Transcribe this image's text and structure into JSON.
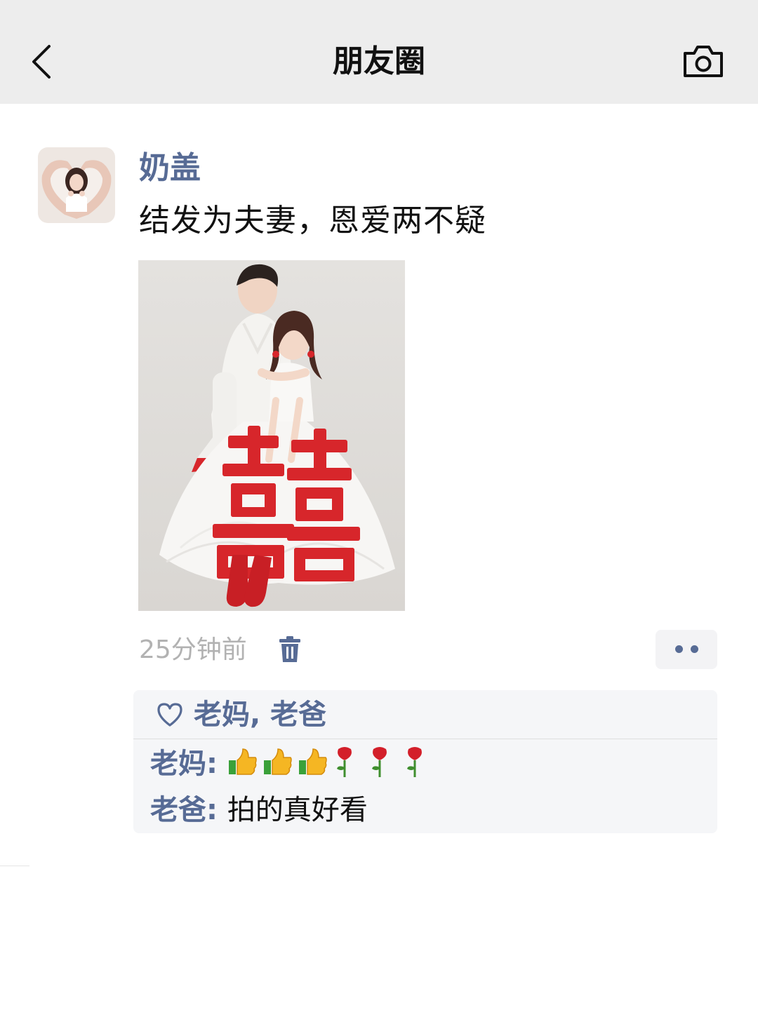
{
  "nav": {
    "title": "朋友圈",
    "back_icon": "chevron-left-icon",
    "camera_icon": "camera-icon"
  },
  "post": {
    "author": "奶盖",
    "text": "结发为夫妻，恩爱两不疑",
    "time": "25分钟前",
    "delete_icon": "trash-icon",
    "more_icon": "more-dots-icon"
  },
  "likes": {
    "names": "老妈, 老爸"
  },
  "comments": [
    {
      "author": "老妈",
      "separator": ": ",
      "content": "👍👍👍🌹🌹🌹"
    },
    {
      "author": "老爸",
      "separator": ": ",
      "content": "拍的真好看"
    }
  ],
  "colors": {
    "nav_bg": "#ededed",
    "link_blue": "#576b95",
    "meta_gray": "#b2b2b2",
    "comment_bg": "#f5f6f8",
    "festive_red": "#d7262b"
  }
}
